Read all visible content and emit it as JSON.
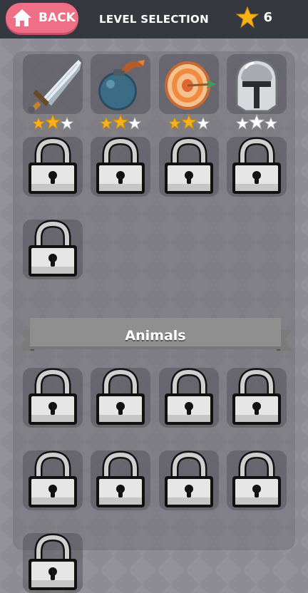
{
  "header": {
    "back_label": "BACK",
    "title": "LEVEL SELECTION",
    "star_total": "6",
    "back_icon": "home-icon",
    "star_icon": "star-icon"
  },
  "colors": {
    "back_button": "#ef6f86",
    "topbar": "#35393f",
    "star_gold": "#f6b21b",
    "star_empty": "#ffffff"
  },
  "sections": [
    {
      "name": "",
      "levels": [
        {
          "icon": "sword-icon",
          "locked": false,
          "stars": 2,
          "max_stars": 3
        },
        {
          "icon": "bomb-icon",
          "locked": false,
          "stars": 2,
          "max_stars": 3
        },
        {
          "icon": "target-icon",
          "locked": false,
          "stars": 2,
          "max_stars": 3
        },
        {
          "icon": "helmet-icon",
          "locked": false,
          "stars": 0,
          "max_stars": 3
        },
        {
          "icon": "lock-icon",
          "locked": true
        },
        {
          "icon": "lock-icon",
          "locked": true
        },
        {
          "icon": "lock-icon",
          "locked": true
        },
        {
          "icon": "lock-icon",
          "locked": true
        },
        {
          "icon": "lock-icon",
          "locked": true
        }
      ]
    },
    {
      "name": "Animals",
      "levels": [
        {
          "icon": "lock-icon",
          "locked": true
        },
        {
          "icon": "lock-icon",
          "locked": true
        },
        {
          "icon": "lock-icon",
          "locked": true
        },
        {
          "icon": "lock-icon",
          "locked": true
        },
        {
          "icon": "lock-icon",
          "locked": true
        },
        {
          "icon": "lock-icon",
          "locked": true
        },
        {
          "icon": "lock-icon",
          "locked": true
        },
        {
          "icon": "lock-icon",
          "locked": true
        },
        {
          "icon": "lock-icon",
          "locked": true
        }
      ]
    }
  ]
}
